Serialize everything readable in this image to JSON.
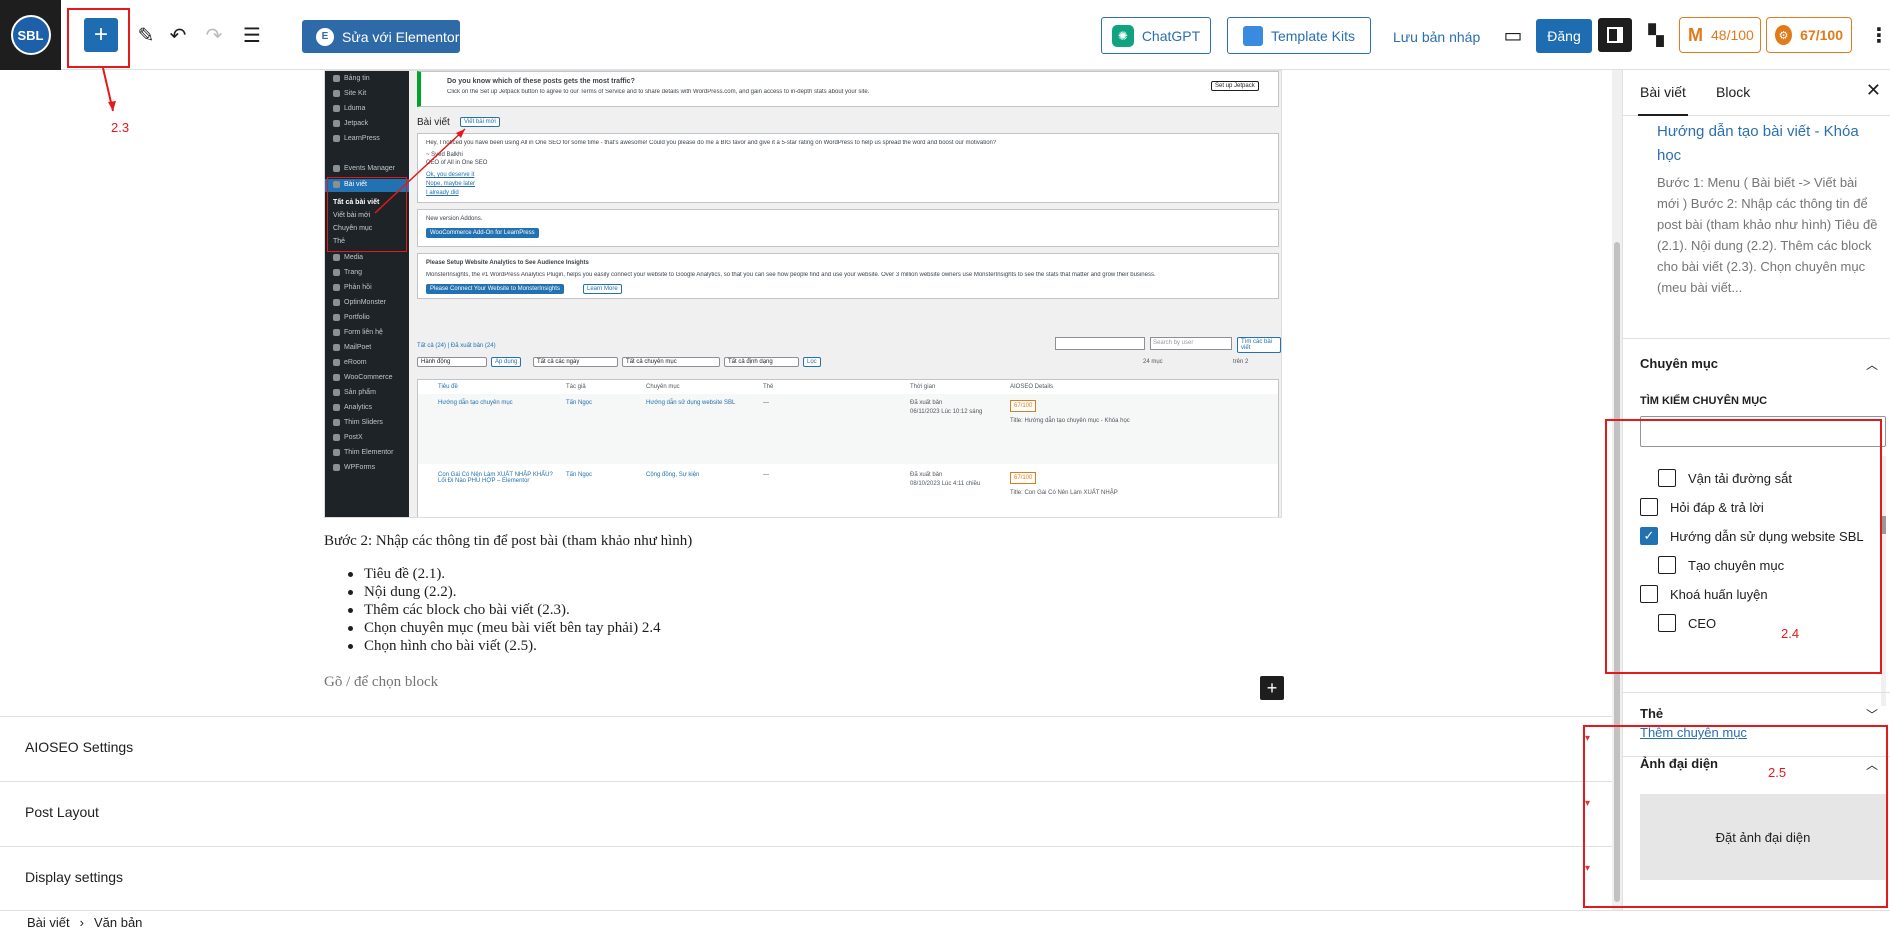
{
  "toolbar": {
    "logo_text": "SBL",
    "elementor_label": "Sửa với Elementor",
    "chatgpt_label": "ChatGPT",
    "kits_label": "Template Kits",
    "draft_label": "Lưu bản nháp",
    "publish_label": "Đăng",
    "score_readability": "48/100",
    "score_seo": "67/100"
  },
  "screenshot": {
    "jetpack_title": "Do you know which of these posts gets the most traffic?",
    "jetpack_text": "Click on the Set up Jetpack button to agree to our Terms of Service and to share details with WordPress.com, and gain access to in-depth stats about your site.",
    "jetpack_btn": "Set up Jetpack",
    "posts_heading": "Bài viết",
    "new_post_btn": "Viết bài mới",
    "aioseo_text": "Hey, I noticed you have been using All in One SEO for some time - that's awesome! Could you please do me a BIG favor and give it a 5-star rating on WordPress to help us spread the word and boost our motivation?",
    "aioseo_sign": "~ Syed Balkhi",
    "aioseo_role": "CEO of All in One SEO",
    "aioseo_links": [
      "Ok, you deserve it",
      "Nope, maybe later",
      "I already did"
    ],
    "addon_text": "New version Addons.",
    "addon_btn": "WooCommerce Add-On for LearnPress",
    "insights_title": "Please Setup Website Analytics to See Audience Insights",
    "insights_text": "MonsterInsights, the #1 WordPress Analytics Plugin, helps you easily connect your website to Google Analytics, so that you can see how people find and use your website. Over 3 million website owners use MonsterInsights to see the stats that matter and grow their business.",
    "insights_btn": "Please Connect Your Website to MonsterInsights",
    "insights_more": "Learn More",
    "filter_all": "Tất cả (24) | Đã xuất bản (24)",
    "filters": [
      "Hành động",
      "Áp dụng",
      "Tất cả các ngày",
      "Tất cả chuyên mục",
      "Tất cả định dạng",
      "Lọc"
    ],
    "search_placeholder": "Search by user",
    "search_btn": "Tìm các bài viết",
    "pagination": "24 mục",
    "page_total": "trên 2",
    "menu": [
      "Bảng tin",
      "Site Kit",
      "Lduma",
      "Jetpack",
      "LearnPress",
      "Events Manager",
      "Bài viết",
      "Media",
      "Trang",
      "Phản hồi",
      "OptinMonster",
      "Portfolio",
      "Form liên hệ",
      "MailPoet",
      "eRoom",
      "WooCommerce",
      "Sản phẩm",
      "Analytics",
      "Thim Sliders",
      "PostX",
      "Thim Elementor",
      "WPForms"
    ],
    "submenu": [
      "Tất cả bài viết",
      "Viết bài mới",
      "Chuyên mục",
      "Thẻ"
    ],
    "columns": [
      "Tiêu đề",
      "Tác giả",
      "Chuyên mục",
      "Thẻ",
      "",
      "Thời gian",
      "AIOSEO Details"
    ],
    "rows": [
      {
        "title": "Hướng dẫn tạo chuyên mục",
        "author": "Tấn Ngọc",
        "category": "Hướng dẫn sử dụng website SBL",
        "tags": "—",
        "status": "Đã xuất bản",
        "date": "06/11/2023 Lúc 10:12 sáng",
        "score": "67/100",
        "seo": "Title: Hướng dẫn tạo chuyên mục - Khóa học"
      },
      {
        "title": "Con Gái Có Nên Làm XUẤT NHẬP KHẨU? Lối Đi Nào PHÙ HỢP – Elementor",
        "author": "Tấn Ngọc",
        "category": "Cộng đồng, Sự kiện",
        "tags": "—",
        "status": "Đã xuất bản",
        "date": "08/10/2023 Lúc 4:11 chiều",
        "score": "67/100",
        "seo": "Title: Con Gái Có Nên Làm XUẤT NHẬP"
      }
    ]
  },
  "content": {
    "paragraph": "Bước 2: Nhập các thông tin để post bài (tham khảo như hình)",
    "items": [
      "Tiêu đề (2.1).",
      "Nội dung (2.2).",
      "Thêm các block  cho bài viết (2.3).",
      "Chọn chuyên mục (meu bài viết bên tay phải) 2.4",
      "Chọn hình cho bài viết (2.5)."
    ],
    "placeholder": "Gõ / để chọn block"
  },
  "metaboxes": [
    "AIOSEO Settings",
    "Post Layout",
    "Display settings"
  ],
  "sidebar": {
    "tab_post": "Bài viết",
    "tab_block": "Block",
    "excerpt_title": "Hướng dẫn tạo bài viết - Khóa học",
    "excerpt": "Bước 1: Menu ( Bài biết -> Viết bài mới ) Bước 2: Nhập các thông tin để post bài (tham khảo như hình) Tiêu đề (2.1). Nội dung (2.2). Thêm các block cho bài viết (2.3). Chọn chuyên mục (meu bài viết...",
    "categories_title": "Chuyên mục",
    "search_label": "TÌM KIẾM CHUYÊN MỤC",
    "categories": [
      {
        "label": "Vận tải đường sắt",
        "checked": false,
        "child": true
      },
      {
        "label": "Hỏi đáp & trả lời",
        "checked": false,
        "child": false
      },
      {
        "label": "Hướng dẫn sử dụng website SBL",
        "checked": true,
        "child": false
      },
      {
        "label": "Tạo chuyên mục",
        "checked": false,
        "child": true
      },
      {
        "label": "Khoá huấn luyện",
        "checked": false,
        "child": false
      },
      {
        "label": "CEO",
        "checked": false,
        "child": true
      }
    ],
    "add_category": "Thêm chuyên mục",
    "tags_title": "Thẻ",
    "featured_title": "Ảnh đại diện",
    "featured_button": "Đặt ảnh đại diện"
  },
  "annotations": {
    "a23": "2.3",
    "a24": "2.4",
    "a25": "2.5"
  },
  "breadcrumb": [
    "Bài viết",
    "Văn bản"
  ],
  "colors": {
    "accent": "#1e6cb2",
    "annotation": "#e3191b",
    "seo_score": "#e07a1a"
  }
}
